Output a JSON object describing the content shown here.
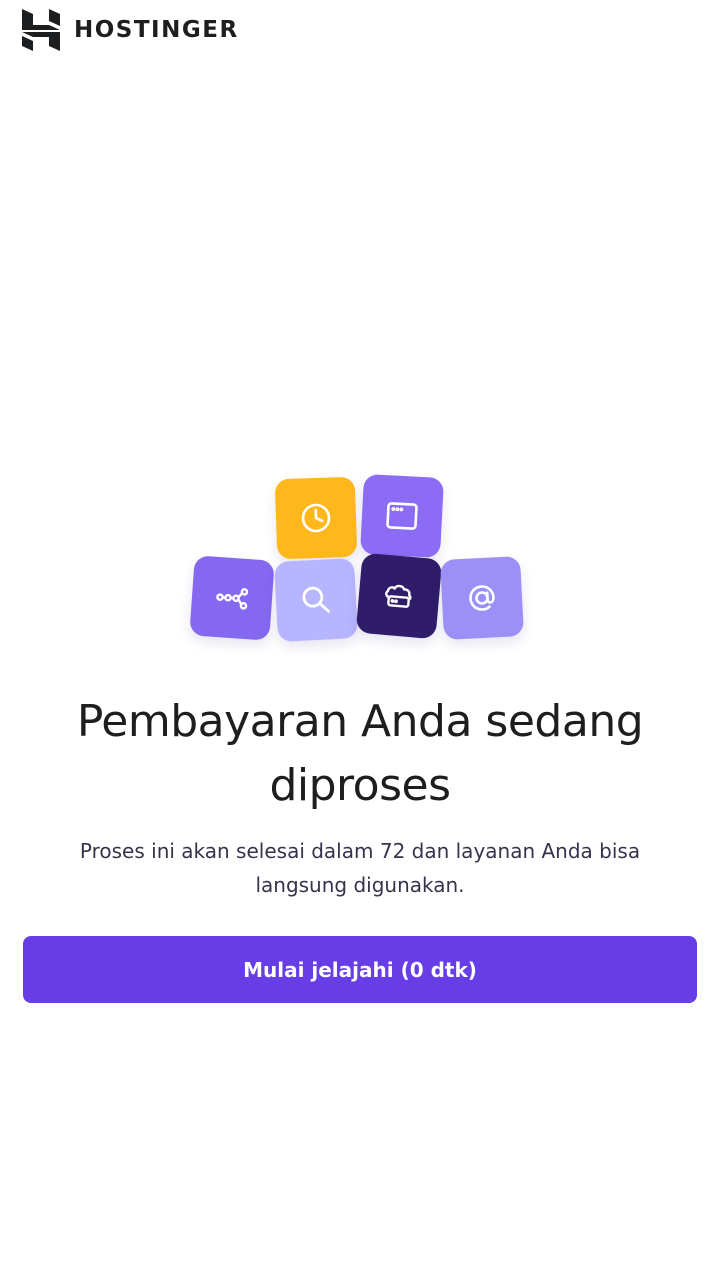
{
  "header": {
    "brand": "HOSTINGER",
    "logo_icon": "hostinger-h-logo"
  },
  "illustration": {
    "tiles": [
      {
        "icon": "clock-icon",
        "color": "#ffb81c"
      },
      {
        "icon": "browser-window-icon",
        "color": "#8c6bf5"
      },
      {
        "icon": "network-nodes-icon",
        "color": "#8568f0"
      },
      {
        "icon": "search-icon",
        "color": "#b7b5ff"
      },
      {
        "icon": "cloud-server-icon",
        "color": "#2f1c6a"
      },
      {
        "icon": "at-sign-icon",
        "color": "#9c8ff5"
      }
    ]
  },
  "main": {
    "title": "Pembayaran Anda sedang diproses",
    "subtitle": "Proses ini akan selesai dalam 72 dan layanan Anda bisa langsung digunakan.",
    "cta_label": "Mulai jelajahi (0 dtk)"
  },
  "colors": {
    "primary": "#673de6",
    "text": "#1d1e20",
    "background": "#ffffff"
  }
}
